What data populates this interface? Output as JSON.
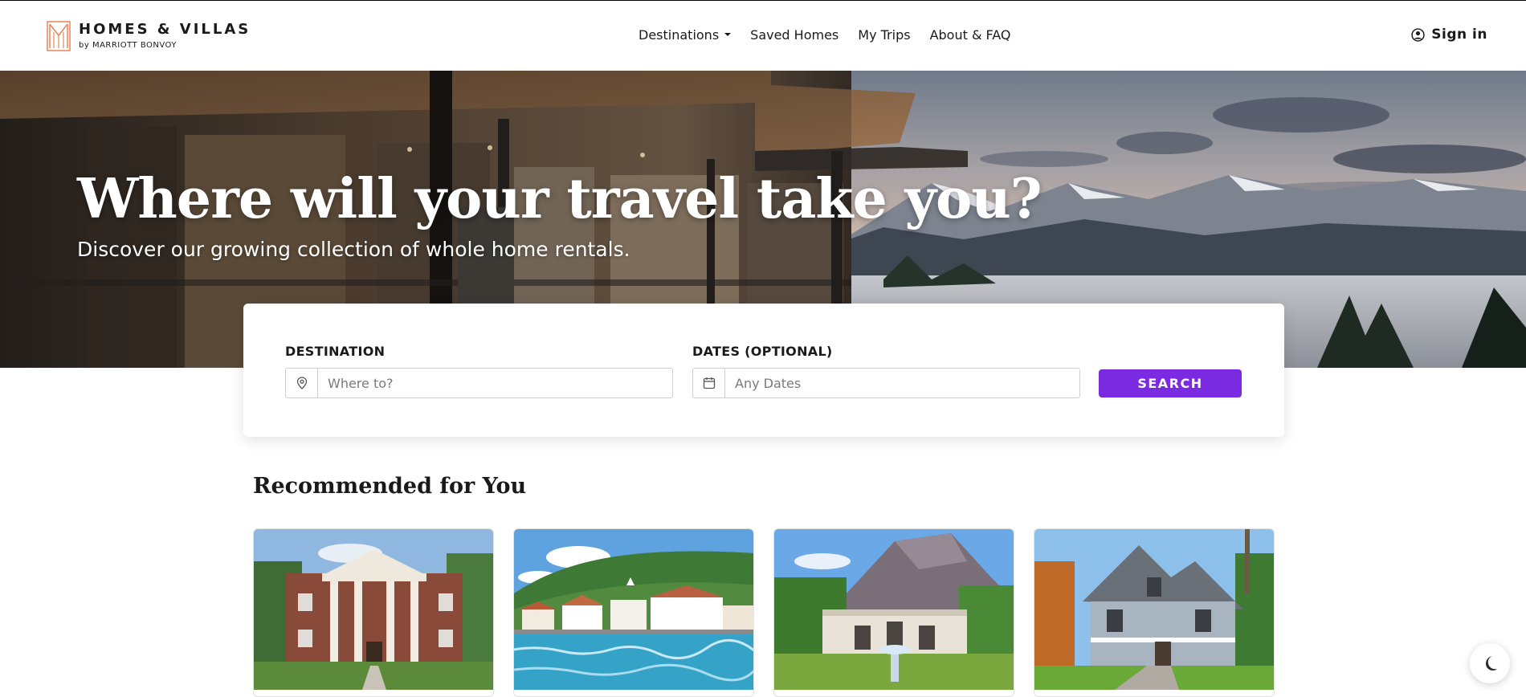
{
  "header": {
    "logo": {
      "title": "HOMES & VILLAS",
      "subtitle": "by MARRIOTT BONVOY",
      "icon": "logo-mark-icon",
      "color": "#e8845a"
    },
    "nav": [
      {
        "label": "Destinations",
        "has_dropdown": true
      },
      {
        "label": "Saved Homes"
      },
      {
        "label": "My Trips"
      },
      {
        "label": "About & FAQ"
      }
    ],
    "signin": {
      "label": "Sign in",
      "icon": "user-circle-icon"
    }
  },
  "hero": {
    "title": "Where will your travel take you?",
    "subtitle": "Discover our growing collection of whole home rentals."
  },
  "search": {
    "destination": {
      "label": "DESTINATION",
      "placeholder": "Where to?",
      "icon": "location-pin-icon"
    },
    "dates": {
      "label": "DATES (OPTIONAL)",
      "placeholder": "Any Dates",
      "icon": "calendar-icon"
    },
    "button": "SEARCH",
    "button_color": "#7a2be2"
  },
  "recommended": {
    "title": "Recommended for You",
    "cards": [
      {
        "image": "colonial-mansion-image"
      },
      {
        "image": "waterfront-villas-image"
      },
      {
        "image": "mountain-palace-image"
      },
      {
        "image": "victorian-house-image"
      }
    ]
  },
  "theme_toggle": {
    "icon": "moon-icon"
  }
}
